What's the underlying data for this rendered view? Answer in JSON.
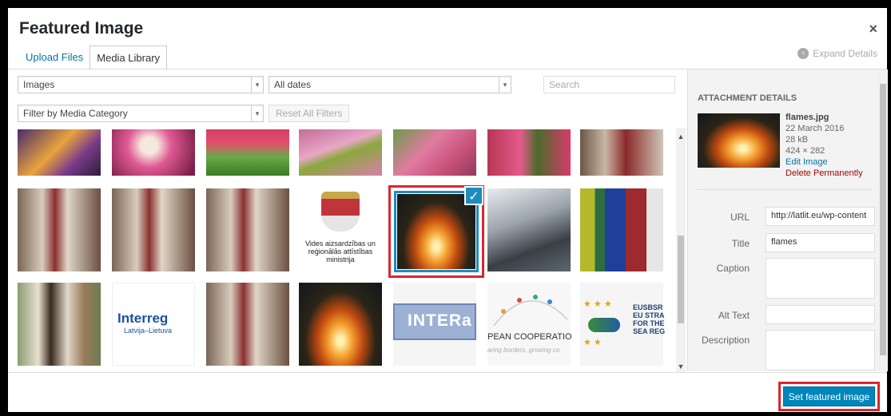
{
  "modal": {
    "title": "Featured Image",
    "close_label": "×",
    "tabs": [
      {
        "label": "Upload Files"
      },
      {
        "label": "Media Library"
      }
    ],
    "expand_details": "Expand Details"
  },
  "toolbar": {
    "type_filter": "Images",
    "date_filter": "All dates",
    "category_filter": "Filter by Media Category",
    "reset_label": "Reset All Filters",
    "search_placeholder": "Search"
  },
  "grid": {
    "colors": [
      "#6b3b7a",
      "#e05a95",
      "#5e9b3a",
      "#d77fa6",
      "#c9517a",
      "#b83655",
      "#7d6b5a",
      "#8a7666",
      "#8a7666",
      "#8a7666",
      "#ffffff",
      "#2a2418",
      "#5d6670",
      "#9aa2ab",
      "#9aa68a",
      "#ffffff",
      "#8a7666",
      "#2a2418",
      "#cfdbe9",
      "#f5f5f5",
      "#f5f5f5"
    ],
    "thumb_texts": {
      "coat_caption": "Vides aizsardzības un reģionālās attīstības ministrija",
      "interreg_title": "Interreg",
      "interreg_sub": "Latvija–Lietuva",
      "intera": "INTERa",
      "coop": "PEAN COOPERATIO",
      "coop_sub": "aring borders, growing co",
      "eusbsr": "EUSBSR\nEU STRA\nFOR THE\nSEA REG"
    },
    "selected_check": "✓"
  },
  "attachment": {
    "heading": "Attachment Details",
    "filename": "flames.jpg",
    "date": "22 March 2016",
    "size": "28 kB",
    "dimensions": "424 × 282",
    "edit_link": "Edit Image",
    "delete_link": "Delete Permanently",
    "fields": {
      "url_label": "URL",
      "url_value": "http://latlit.eu/wp-content",
      "title_label": "Title",
      "title_value": "flames",
      "caption_label": "Caption",
      "alt_label": "Alt Text",
      "description_label": "Description"
    }
  },
  "footer": {
    "set_button": "Set featured image"
  }
}
